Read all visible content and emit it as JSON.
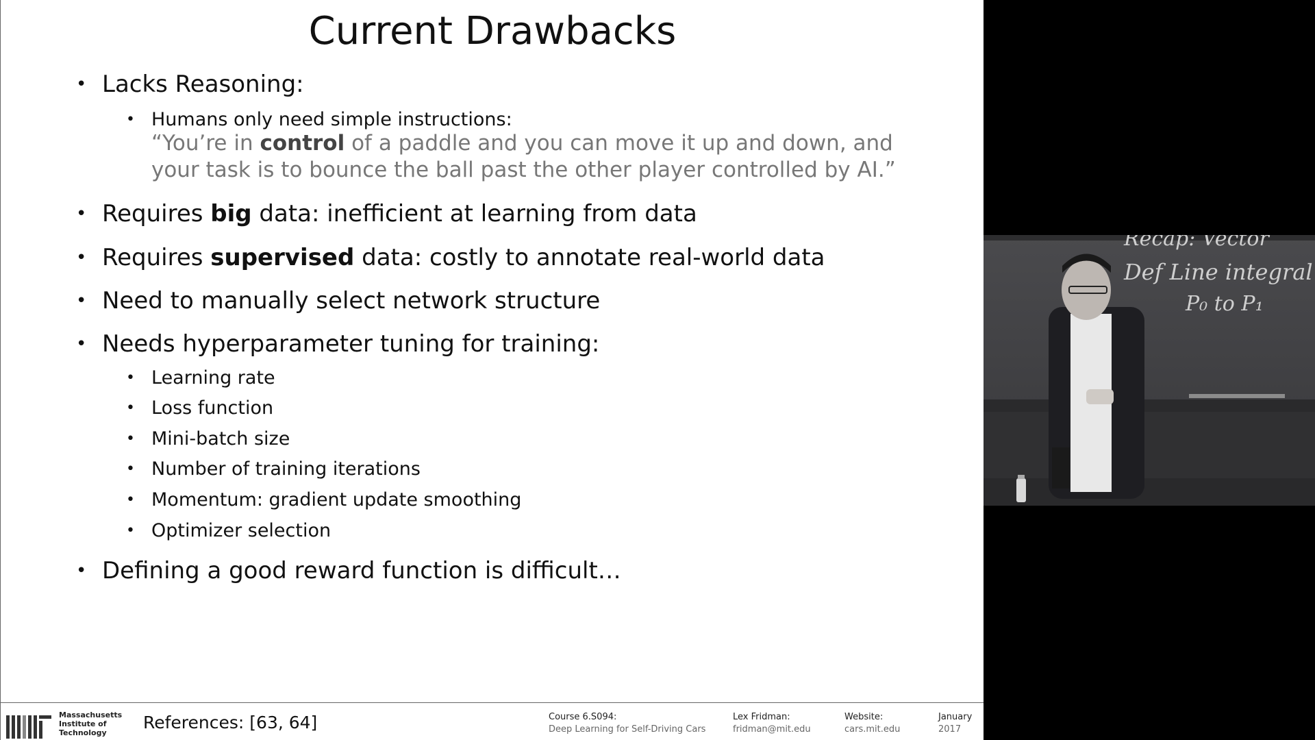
{
  "slide": {
    "title": "Current Drawbacks",
    "bullets": {
      "b1": "Lacks Reasoning:",
      "b1_sub": "Humans only need simple instructions:",
      "quote_pre": "“You’re in ",
      "quote_bold": "control",
      "quote_post": " of a paddle and you can move it up and down, and your task is to bounce the ball past the other player controlled by AI.”",
      "b2_pre": "Requires ",
      "b2_bold": "big",
      "b2_post": " data: inefficient at learning from data",
      "b3_pre": "Requires ",
      "b3_bold": "supervised",
      "b3_post": " data: costly to annotate real-world data",
      "b4": "Need to manually select network structure",
      "b5": "Needs hyperparameter tuning for training:",
      "b5_subs": [
        "Learning rate",
        "Loss function",
        "Mini-batch size",
        "Number of training iterations",
        "Momentum: gradient update smoothing",
        "Optimizer selection"
      ],
      "b6": "Defining a good reward function is difficult…"
    }
  },
  "footer": {
    "mit_name_1": "Massachusetts",
    "mit_name_2": "Institute of",
    "mit_name_3": "Technology",
    "references": "References: [63, 64]",
    "course_label": "Course 6.S094:",
    "course_name": "Deep Learning for Self-Driving Cars",
    "author_label": "Lex Fridman:",
    "author_email": "fridman@mit.edu",
    "website_label": "Website:",
    "website_url": "cars.mit.edu",
    "month": "January",
    "year": "2017"
  },
  "video": {
    "board_line_1": "Recap: Vector",
    "board_line_2": "Def  Line integral",
    "board_line_3": "P₀ to P₁"
  }
}
